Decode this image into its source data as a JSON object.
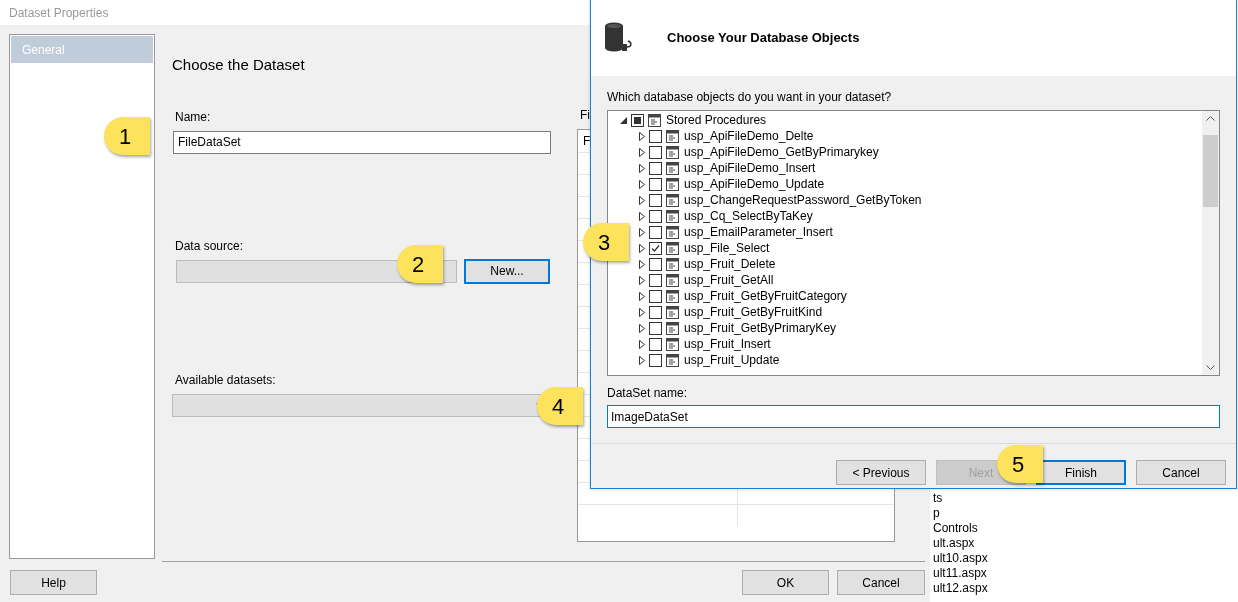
{
  "dataset_properties": {
    "title": "Dataset Properties",
    "sidebar": [
      {
        "label": "General",
        "selected": true
      }
    ],
    "heading": "Choose the Dataset",
    "name_label": "Name:",
    "name_value": "FileDataSet",
    "data_source_label": "Data source:",
    "new_button": "New...",
    "available_label": "Available datasets:",
    "fields_label": "Fi",
    "fields_header": "F",
    "help_button": "Help",
    "ok_button": "OK",
    "cancel_button": "Cancel"
  },
  "wizard": {
    "heading": "Choose Your Database Objects",
    "prompt": "Which database objects do you want in your dataset?",
    "tree": {
      "label": "Stored Procedures",
      "expanded": true,
      "checked": false,
      "partial": true,
      "children": [
        {
          "label": "usp_ApiFileDemo_Delte",
          "checked": false
        },
        {
          "label": "usp_ApiFileDemo_GetByPrimarykey",
          "checked": false
        },
        {
          "label": "usp_ApiFileDemo_Insert",
          "checked": false
        },
        {
          "label": "usp_ApiFileDemo_Update",
          "checked": false
        },
        {
          "label": "usp_ChangeRequestPassword_GetByToken",
          "checked": false
        },
        {
          "label": "usp_Cq_SelectByTaKey",
          "checked": false
        },
        {
          "label": "usp_EmailParameter_Insert",
          "checked": false
        },
        {
          "label": "usp_File_Select",
          "checked": true
        },
        {
          "label": "usp_Fruit_Delete",
          "checked": false
        },
        {
          "label": "usp_Fruit_GetAll",
          "checked": false
        },
        {
          "label": "usp_Fruit_GetByFruitCategory",
          "checked": false
        },
        {
          "label": "usp_Fruit_GetByFruitKind",
          "checked": false
        },
        {
          "label": "usp_Fruit_GetByPrimaryKey",
          "checked": false
        },
        {
          "label": "usp_Fruit_Insert",
          "checked": false
        },
        {
          "label": "usp_Fruit_Update",
          "checked": false
        }
      ]
    },
    "dataset_name_label": "DataSet name:",
    "dataset_name_value": "ImageDataSet",
    "buttons": [
      {
        "label": "< Previous",
        "disabled": false,
        "focused": false
      },
      {
        "label": "Next",
        "disabled": true,
        "focused": false
      },
      {
        "label": "Finish",
        "disabled": false,
        "focused": true
      },
      {
        "label": "Cancel",
        "disabled": false,
        "focused": false
      }
    ]
  },
  "background_list": [
    "ts",
    "p",
    "Controls",
    "ult.aspx",
    "ult10.aspx",
    "ult11.aspx",
    "ult12.aspx"
  ],
  "callouts": [
    "1",
    "2",
    "3",
    "4",
    "5"
  ]
}
